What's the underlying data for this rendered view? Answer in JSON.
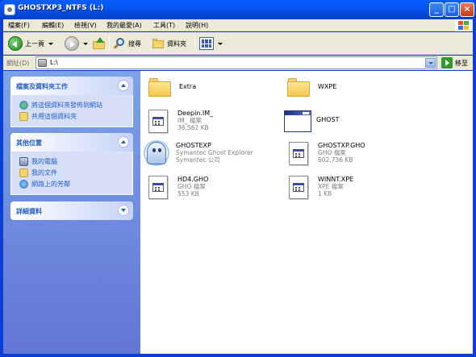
{
  "window": {
    "title": "GHOSTXP3_NTFS (L:)",
    "colors": {
      "titlebar": "#0455f0",
      "taskpane": "#6b86da",
      "link": "#215dc6"
    }
  },
  "menubar": {
    "items": [
      "檔案(F)",
      "編輯(E)",
      "檢視(V)",
      "我的最愛(A)",
      "工具(T)",
      "說明(H)"
    ]
  },
  "toolbar": {
    "back_label": "上一頁",
    "search_label": "搜尋",
    "folders_label": "資料夾"
  },
  "address": {
    "label": "網址(D)",
    "value": "L:\\",
    "go_label": "移至"
  },
  "taskpane": {
    "file_tasks": {
      "title": "檔案及資料夾工作",
      "items": [
        "將這個資料夾發佈到網站",
        "共用這個資料夾"
      ]
    },
    "other_places": {
      "title": "其他位置",
      "items": [
        "我的電腦",
        "我的文件",
        "網路上的芳鄰"
      ]
    },
    "details": {
      "title": "詳細資料"
    }
  },
  "files": [
    {
      "name": "Extra",
      "type": "folder",
      "line2": "",
      "line3": ""
    },
    {
      "name": "WXPE",
      "type": "folder",
      "line2": "",
      "line3": ""
    },
    {
      "name": "Deepin.IM_",
      "type": "doc",
      "line2": "IM_ 檔案",
      "line3": "36,562 KB"
    },
    {
      "name": "GHOST",
      "type": "app",
      "line2": "",
      "line3": ""
    },
    {
      "name": "GHOSTEXP",
      "type": "ghost",
      "line2": "Symantec Ghost Explorer",
      "line3": "Symantec 公司"
    },
    {
      "name": "GHOSTXP.GHO",
      "type": "doc",
      "line2": "GHO 檔案",
      "line3": "602,736 KB"
    },
    {
      "name": "HD4.GHO",
      "type": "doc",
      "line2": "GHO 檔案",
      "line3": "553 KB"
    },
    {
      "name": "WINNT.XPE",
      "type": "doc",
      "line2": "XPE 檔案",
      "line3": "1 KB"
    }
  ]
}
